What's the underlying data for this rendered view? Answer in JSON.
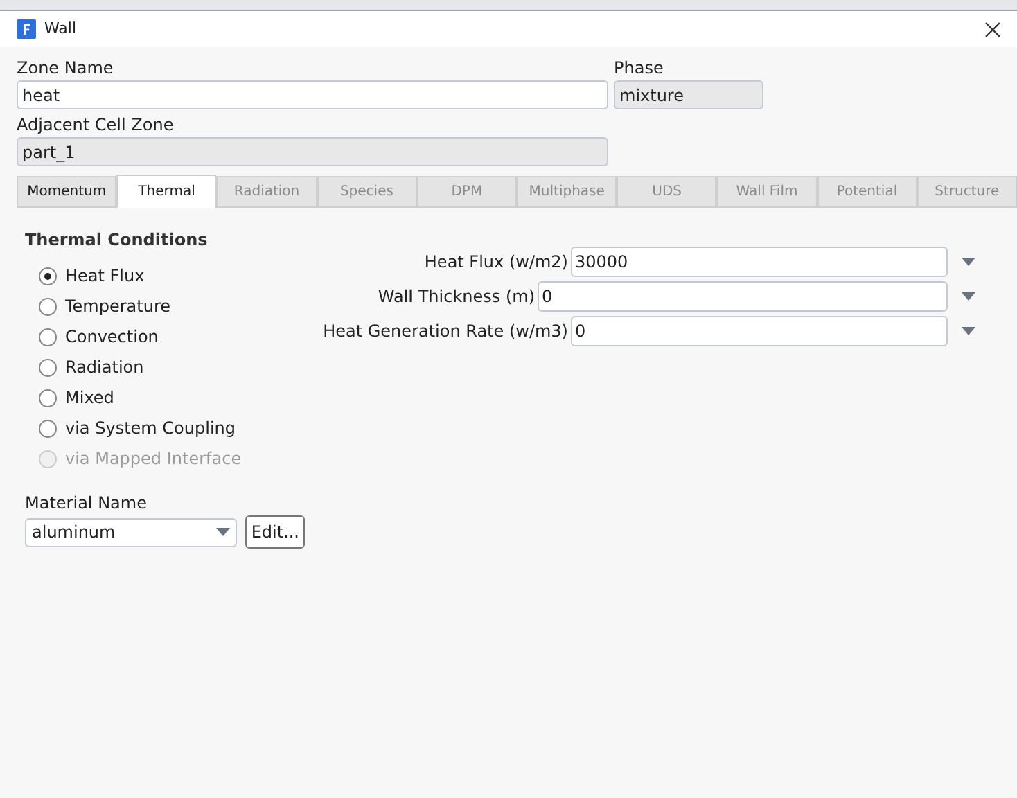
{
  "window": {
    "title": "Wall"
  },
  "zone_name": {
    "label": "Zone Name",
    "value": "heat"
  },
  "phase": {
    "label": "Phase",
    "value": "mixture"
  },
  "adjacent_cell_zone": {
    "label": "Adjacent Cell Zone",
    "value": "part_1"
  },
  "tabs": [
    {
      "label": "Momentum",
      "selected": false,
      "disabled": false
    },
    {
      "label": "Thermal",
      "selected": true,
      "disabled": false
    },
    {
      "label": "Radiation",
      "selected": false,
      "disabled": true
    },
    {
      "label": "Species",
      "selected": false,
      "disabled": true
    },
    {
      "label": "DPM",
      "selected": false,
      "disabled": true
    },
    {
      "label": "Multiphase",
      "selected": false,
      "disabled": true
    },
    {
      "label": "UDS",
      "selected": false,
      "disabled": true
    },
    {
      "label": "Wall Film",
      "selected": false,
      "disabled": true
    },
    {
      "label": "Potential",
      "selected": false,
      "disabled": true
    },
    {
      "label": "Structure",
      "selected": false,
      "disabled": true
    }
  ],
  "thermal_conditions": {
    "title": "Thermal Conditions",
    "options": [
      {
        "label": "Heat Flux",
        "selected": true,
        "disabled": false
      },
      {
        "label": "Temperature",
        "selected": false,
        "disabled": false
      },
      {
        "label": "Convection",
        "selected": false,
        "disabled": false
      },
      {
        "label": "Radiation",
        "selected": false,
        "disabled": false
      },
      {
        "label": "Mixed",
        "selected": false,
        "disabled": false
      },
      {
        "label": "via System Coupling",
        "selected": false,
        "disabled": false
      },
      {
        "label": "via Mapped Interface",
        "selected": false,
        "disabled": true
      }
    ]
  },
  "parameters": [
    {
      "label": "Heat Flux (w/m2)",
      "value": "30000"
    },
    {
      "label": "Wall Thickness (m)",
      "value": "0"
    },
    {
      "label": "Heat Generation Rate (w/m3)",
      "value": "0"
    }
  ],
  "material": {
    "label": "Material Name",
    "value": "aluminum",
    "edit_button": "Edit..."
  }
}
